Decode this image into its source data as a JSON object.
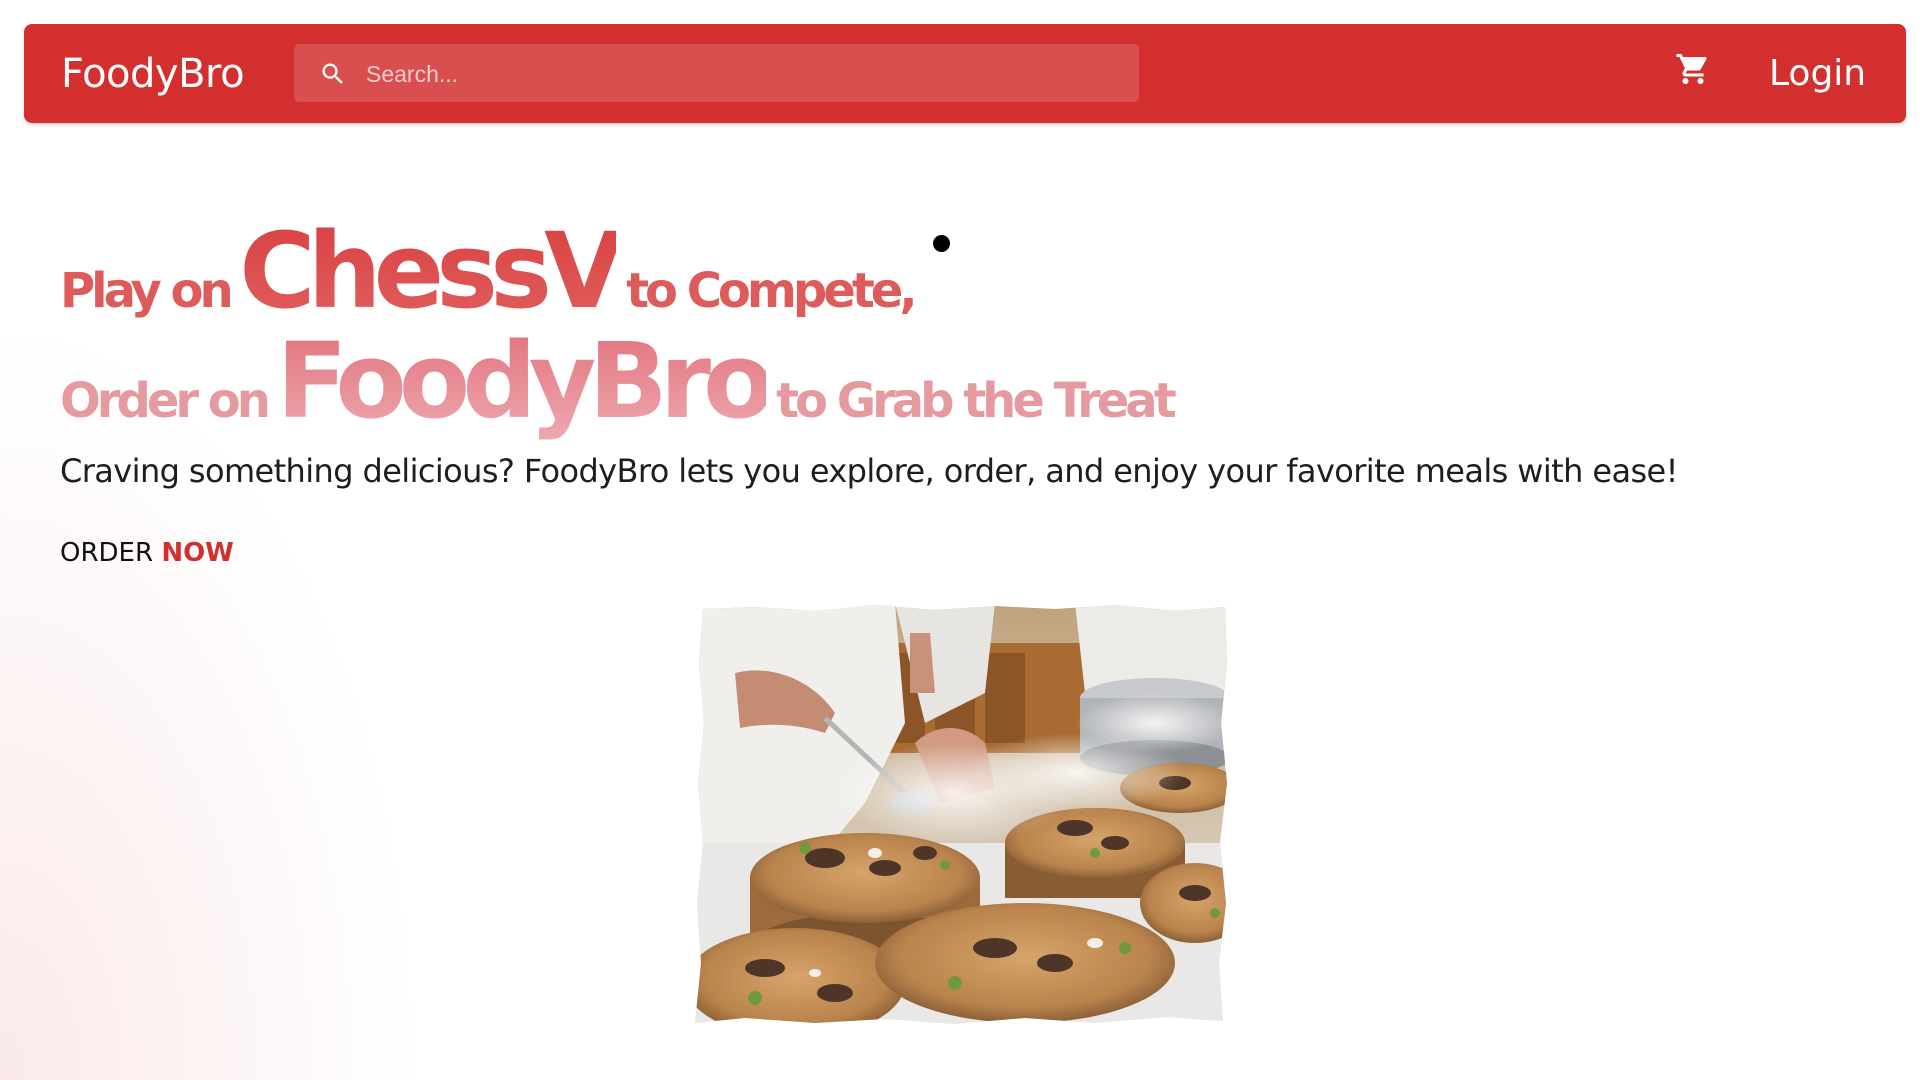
{
  "app": {
    "brand": "FoodyBro"
  },
  "navbar": {
    "search": {
      "placeholder": "Search...",
      "value": ""
    },
    "icons": {
      "search": "search-icon",
      "cart": "shopping-cart-icon"
    },
    "login_label": "Login",
    "color": "#d32f2f"
  },
  "hero": {
    "line1": {
      "prefix": "Play on",
      "highlight": "ChessV",
      "suffix": "to Compete,"
    },
    "line2": {
      "prefix": "Order on",
      "highlight": "FoodyBro",
      "suffix": "to Grab the Treat"
    },
    "subtitle": "Craving something delicious? FoodyBro lets you explore, order, and enjoy your favorite meals with ease!",
    "cta": {
      "first": "ORDER",
      "second": "NOW"
    },
    "accent_color": "#d32f2f"
  }
}
